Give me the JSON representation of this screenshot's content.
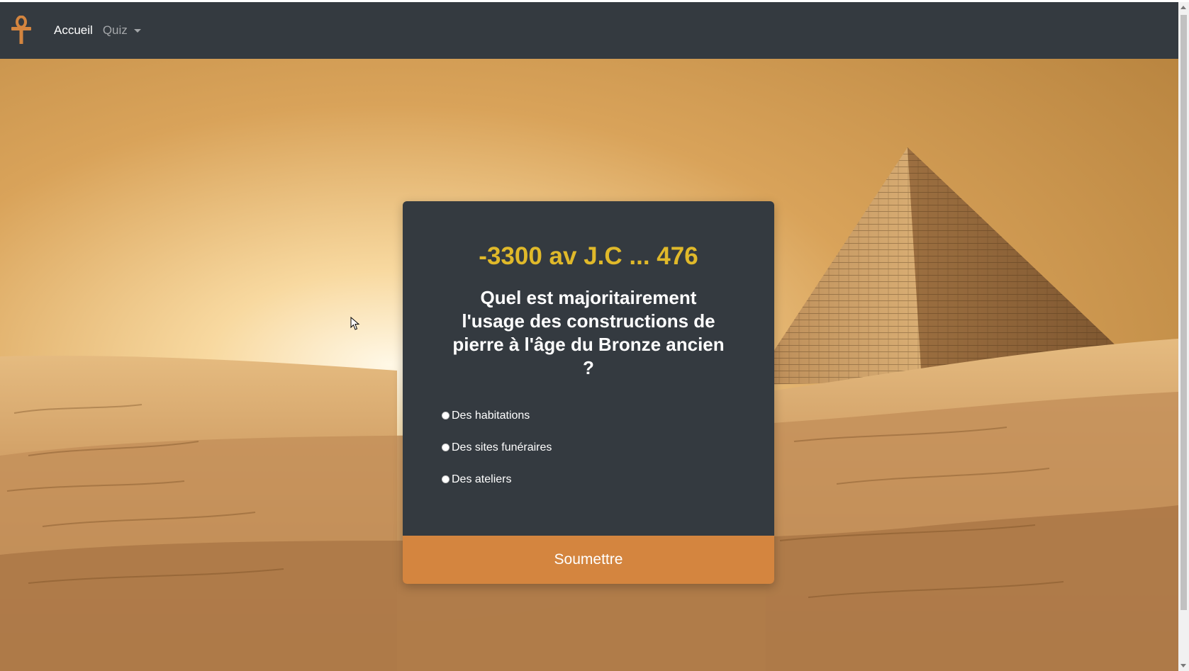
{
  "navbar": {
    "logo_icon": "ankh-icon",
    "home_label": "Accueil",
    "quiz_label": "Quiz"
  },
  "quiz": {
    "period": "-3300 av J.C ... 476",
    "question": "Quel est majoritairement l'usage des constructions de pierre à l'âge du Bronze ancien ?",
    "answers": [
      {
        "label": "Des habitations"
      },
      {
        "label": "Des sites funéraires"
      },
      {
        "label": "Des ateliers"
      }
    ],
    "submit_label": "Soumettre"
  },
  "colors": {
    "navbar_bg": "#343a40",
    "card_bg": "#343a40",
    "period_color": "#e0b92a",
    "submit_bg": "#d4853f"
  }
}
